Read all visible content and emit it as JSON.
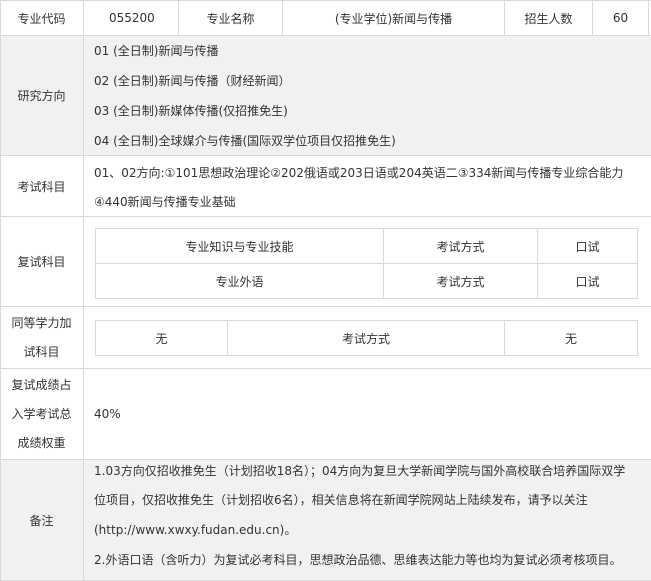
{
  "header": {
    "code_label": "专业代码",
    "code_value": "055200",
    "name_label": "专业名称",
    "name_value": "(专业学位)新闻与传播",
    "enroll_label": "招生人数",
    "enroll_value": "60"
  },
  "research": {
    "label": "研究方向",
    "items": [
      "01 (全日制)新闻与传播",
      "02 (全日制)新闻与传播（财经新闻）",
      "03 (全日制)新媒体传播(仅招推免生)",
      "04 (全日制)全球媒介与传播(国际双学位项目仅招推免生)"
    ]
  },
  "exam": {
    "label": "考试科目",
    "line1": "01、02方向:①101思想政治理论②202俄语或203日语或204英语二③334新闻与传播专业综合能力",
    "line2": "④440新闻与传播专业基础"
  },
  "retest": {
    "label": "复试科目",
    "rows": [
      [
        "专业知识与专业技能",
        "考试方式",
        "口试"
      ],
      [
        "专业外语",
        "考试方式",
        "口试"
      ]
    ]
  },
  "equivalent": {
    "label_line1": "同等学力加",
    "label_line2": "试科目",
    "row": [
      "无",
      "考试方式",
      "无"
    ]
  },
  "weight": {
    "label_line1": "复试成绩占",
    "label_line2": "入学考试总",
    "label_line3": "成绩权重",
    "value": "40%"
  },
  "remarks": {
    "label": "备注",
    "line1": "1.03方向仅招收推免生（计划招收18名）；04方向为复旦大学新闻学院与国外高校联合培养国际双学",
    "line2": "位项目，仅招收推免生（计划招收6名），相关信息将在新闻学院网站上陆续发布，请予以关注",
    "line3": "(http://www.xwxy.fudan.edu.cn)。",
    "line4": "2.外语口语（含听力）为复试必考科目，思想政治品德、思维表达能力等也均为复试必须考核项目。"
  }
}
